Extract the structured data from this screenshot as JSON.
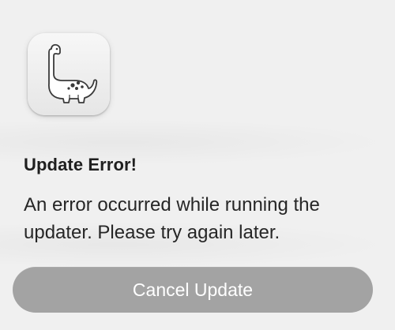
{
  "dialog": {
    "icon": "dinosaur-app-icon",
    "title": "Update Error!",
    "message": "An error occurred while running the updater. Please try again later.",
    "cancel_button_label": "Cancel Update"
  },
  "colors": {
    "background": "#f0f0f0",
    "button_bg": "#a3a3a3",
    "button_text": "#ffffff",
    "text": "#262626"
  }
}
